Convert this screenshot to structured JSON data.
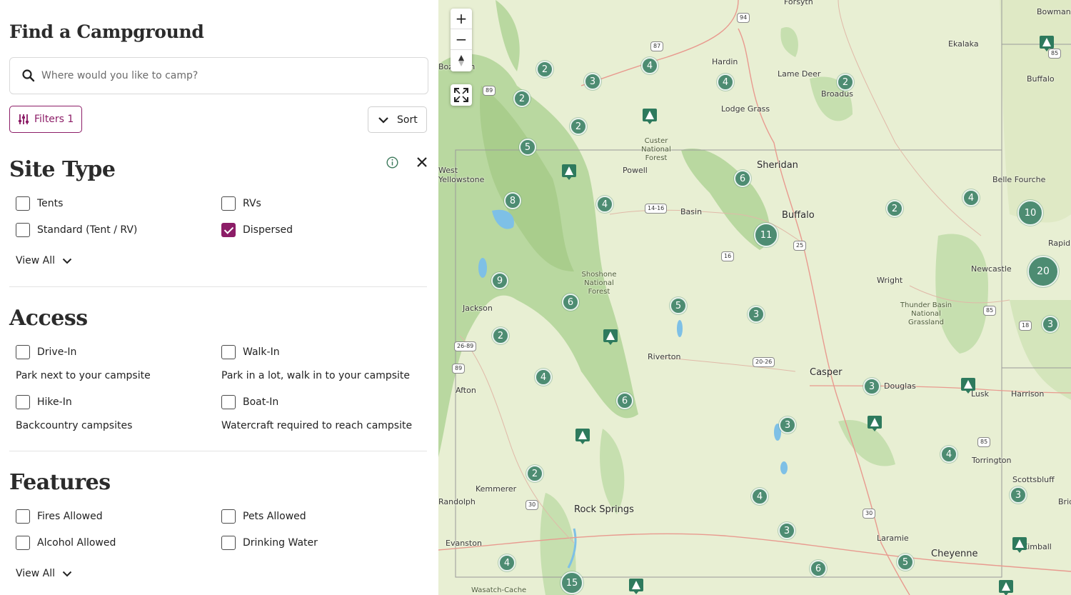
{
  "sidebar": {
    "title": "Find a Campground",
    "search_placeholder": "Where would you like to camp?",
    "filters_label": "Filters 1",
    "sort_label": "Sort",
    "accent_color": "#8c1d67",
    "sections": {
      "site_type": {
        "title": "Site Type",
        "options": [
          {
            "label": "Tents",
            "checked": false
          },
          {
            "label": "RVs",
            "checked": false
          },
          {
            "label": "Standard (Tent / RV)",
            "checked": false
          },
          {
            "label": "Dispersed",
            "checked": true
          }
        ],
        "view_all": "View All"
      },
      "access": {
        "title": "Access",
        "options": [
          {
            "label": "Drive-In",
            "desc": "Park next to your campsite",
            "checked": false
          },
          {
            "label": "Walk-In",
            "desc": "Park in a lot, walk in to your campsite",
            "checked": false
          },
          {
            "label": "Hike-In",
            "desc": "Backcountry campsites",
            "checked": false
          },
          {
            "label": "Boat-In",
            "desc": "Watercraft required to reach campsite",
            "checked": false
          }
        ]
      },
      "features": {
        "title": "Features",
        "options": [
          {
            "label": "Fires Allowed",
            "checked": false
          },
          {
            "label": "Pets Allowed",
            "checked": false
          },
          {
            "label": "Alcohol Allowed",
            "checked": false
          },
          {
            "label": "Drinking Water",
            "checked": false
          }
        ],
        "view_all": "View All"
      }
    }
  },
  "map": {
    "controls": {
      "zoom_in": "+",
      "zoom_out": "−"
    },
    "cluster_color": "#4d8c72",
    "labels": {
      "forsyth": "Forsyth",
      "bowman": "Bowman",
      "ekalaka": "Ekalaka",
      "hardin": "Hardin",
      "lame_deer": "Lame Deer",
      "broadus": "Broadus",
      "buffalo_sd": "Buffalo",
      "bozeman": "Bozeman",
      "lodge_grass": "Lodge Grass",
      "custer_nf": "Custer National Forest",
      "west_yellowstone": "West Yellowstone",
      "powell": "Powell",
      "sheridan": "Sheridan",
      "belle_fourche": "Belle Fourche",
      "basin": "Basin",
      "buffalo": "Buffalo",
      "rapid": "Rapid",
      "shoshone_nf": "Shoshone National Forest",
      "newcastle": "Newcastle",
      "wright": "Wright",
      "thunder_basin": "Thunder Basin National Grassland",
      "jackson": "Jackson",
      "riverton": "Riverton",
      "casper": "Casper",
      "afton": "Afton",
      "douglas": "Douglas",
      "harrison": "Harrison",
      "torrington": "Torrington",
      "scottsbluff": "Scottsbluff",
      "kemmerer": "Kemmerer",
      "randolph": "Randolph",
      "rock_springs": "Rock Springs",
      "laramie": "Laramie",
      "bridgeport": "Bridgeport",
      "evanston": "Evanston",
      "cheyenne": "Cheyenne",
      "kimball": "Kimball",
      "wasatch": "Wasatch-Cache",
      "lusk": "Lusk"
    },
    "shields": [
      "94",
      "87",
      "89",
      "85",
      "14-16",
      "25",
      "16",
      "26-89",
      "89",
      "20-26",
      "85",
      "18",
      "85",
      "30",
      "30"
    ],
    "clusters": [
      "2",
      "4",
      "3",
      "4",
      "2",
      "2",
      "2",
      "5",
      "6",
      "8",
      "4",
      "11",
      "2",
      "4",
      "10",
      "20",
      "9",
      "6",
      "5",
      "3",
      "2",
      "4",
      "6",
      "3",
      "3",
      "3",
      "4",
      "2",
      "4",
      "3",
      "6",
      "5",
      "4",
      "15",
      "3"
    ]
  }
}
